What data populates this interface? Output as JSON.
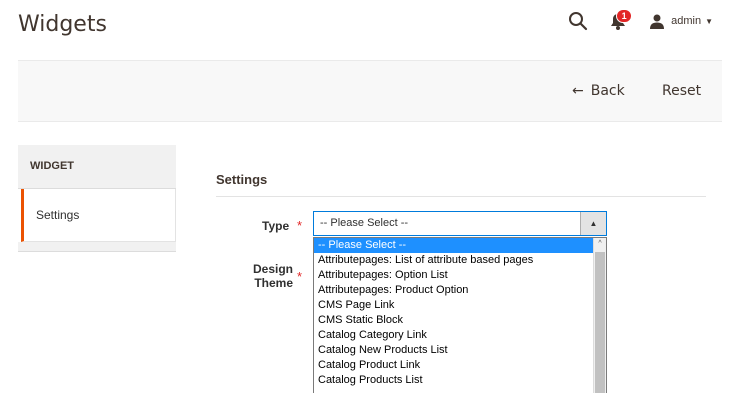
{
  "page": {
    "title": "Widgets"
  },
  "header": {
    "notification_count": "1",
    "user_name": "admin",
    "caret": "▼"
  },
  "actions": {
    "back_label": "Back",
    "back_arrow": "←",
    "reset_label": "Reset"
  },
  "sidebar": {
    "title": "WIDGET",
    "items": [
      {
        "label": "Settings",
        "active": true
      }
    ]
  },
  "settings": {
    "title": "Settings",
    "type_label": "Type",
    "type_value": "-- Please Select --",
    "design_theme_label_line1": "Design",
    "design_theme_label_line2": "Theme",
    "required_mark": "*"
  },
  "dropdown": {
    "scroll_up": "^",
    "options": [
      "-- Please Select --",
      "Attributepages: List of attribute based pages",
      "Attributepages: Option List",
      "Attributepages: Product Option",
      "CMS Page Link",
      "CMS Static Block",
      "Catalog Category Link",
      "Catalog New Products List",
      "Catalog Product Link",
      "Catalog Products List"
    ],
    "selected_index": 0
  },
  "colors": {
    "accent": "#eb5202",
    "focus": "#007bdb",
    "selection": "#1e90ff",
    "badge": "#e22626"
  }
}
